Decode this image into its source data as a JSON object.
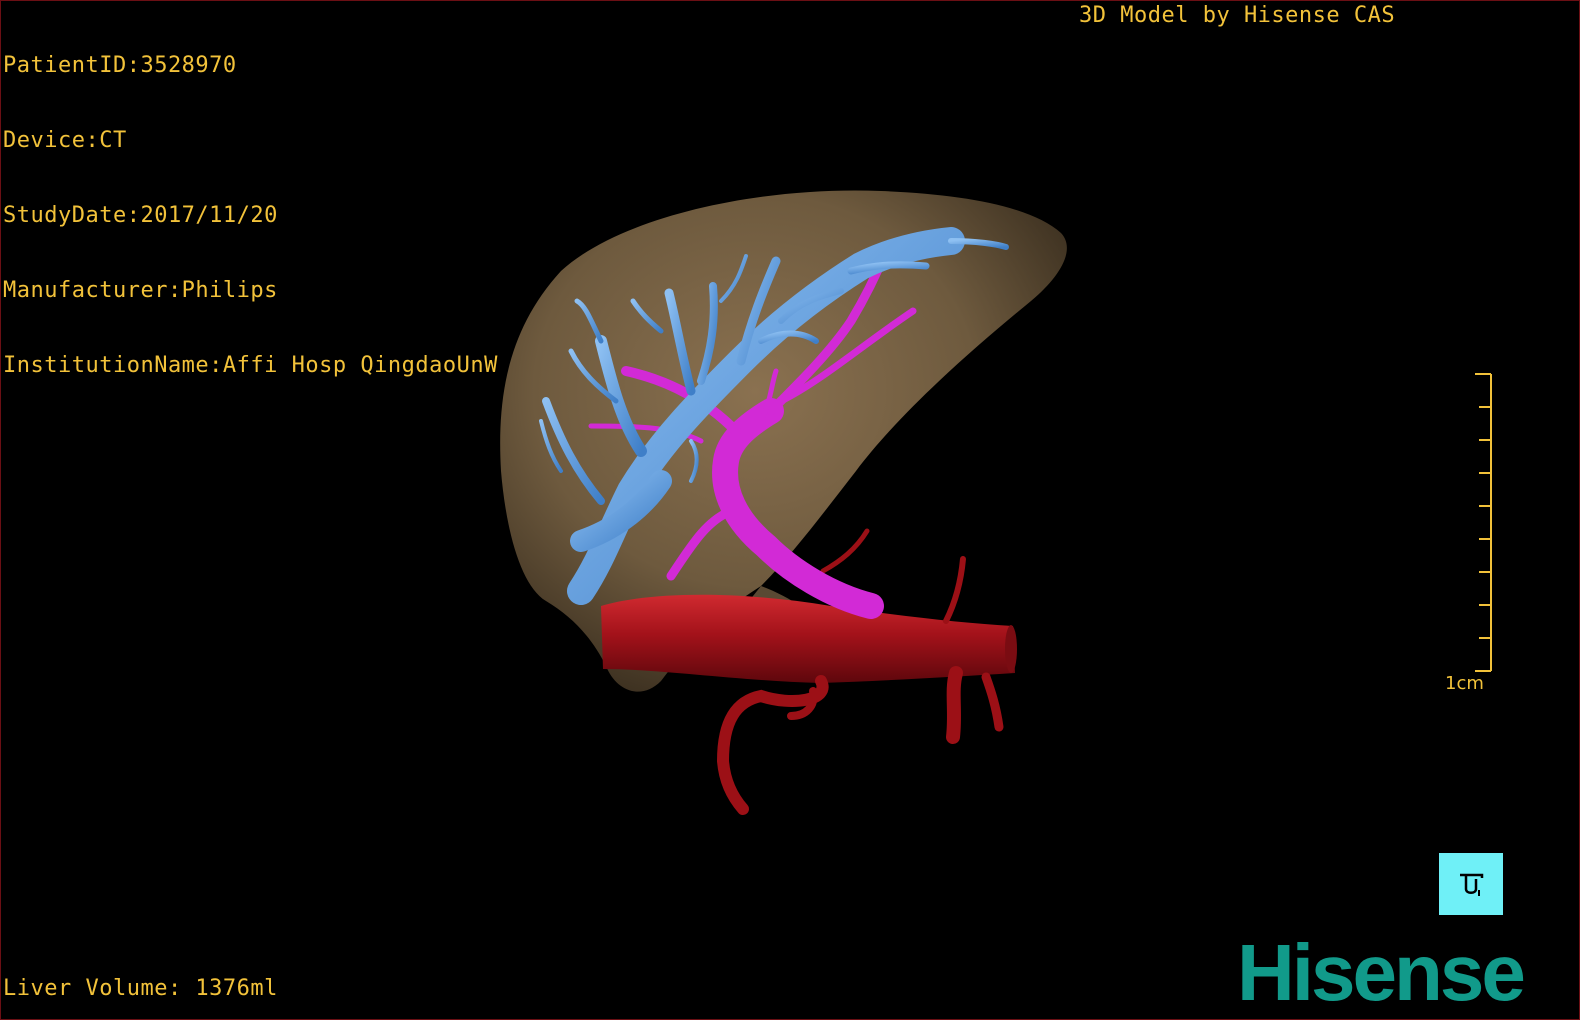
{
  "patient_info": {
    "patient_id": "PatientID:3528970",
    "device": "Device:CT",
    "study_date": "StudyDate:2017/11/20",
    "manufacturer": "Manufacturer:Philips",
    "institution": "InstitutionName:Affi Hosp QingdaoUnW"
  },
  "header_right": "3D Model by Hisense CAS",
  "footer": {
    "liver_volume": "Liver Volume: 1376ml"
  },
  "scale": {
    "label": "1cm",
    "color": "#f2c23a"
  },
  "orientation_button": {
    "icon": "orientation-cube-icon",
    "color": "#6ff0f7"
  },
  "logo": {
    "text": "Hisense",
    "color": "#119a8a"
  },
  "colors": {
    "liver": "#6e5a3e",
    "hepatic_vein": "#5b9be0",
    "portal_vein": "#d22ad6",
    "inferior_vena_cava": "#a3121a",
    "overlay_text": "#f2c23a"
  }
}
